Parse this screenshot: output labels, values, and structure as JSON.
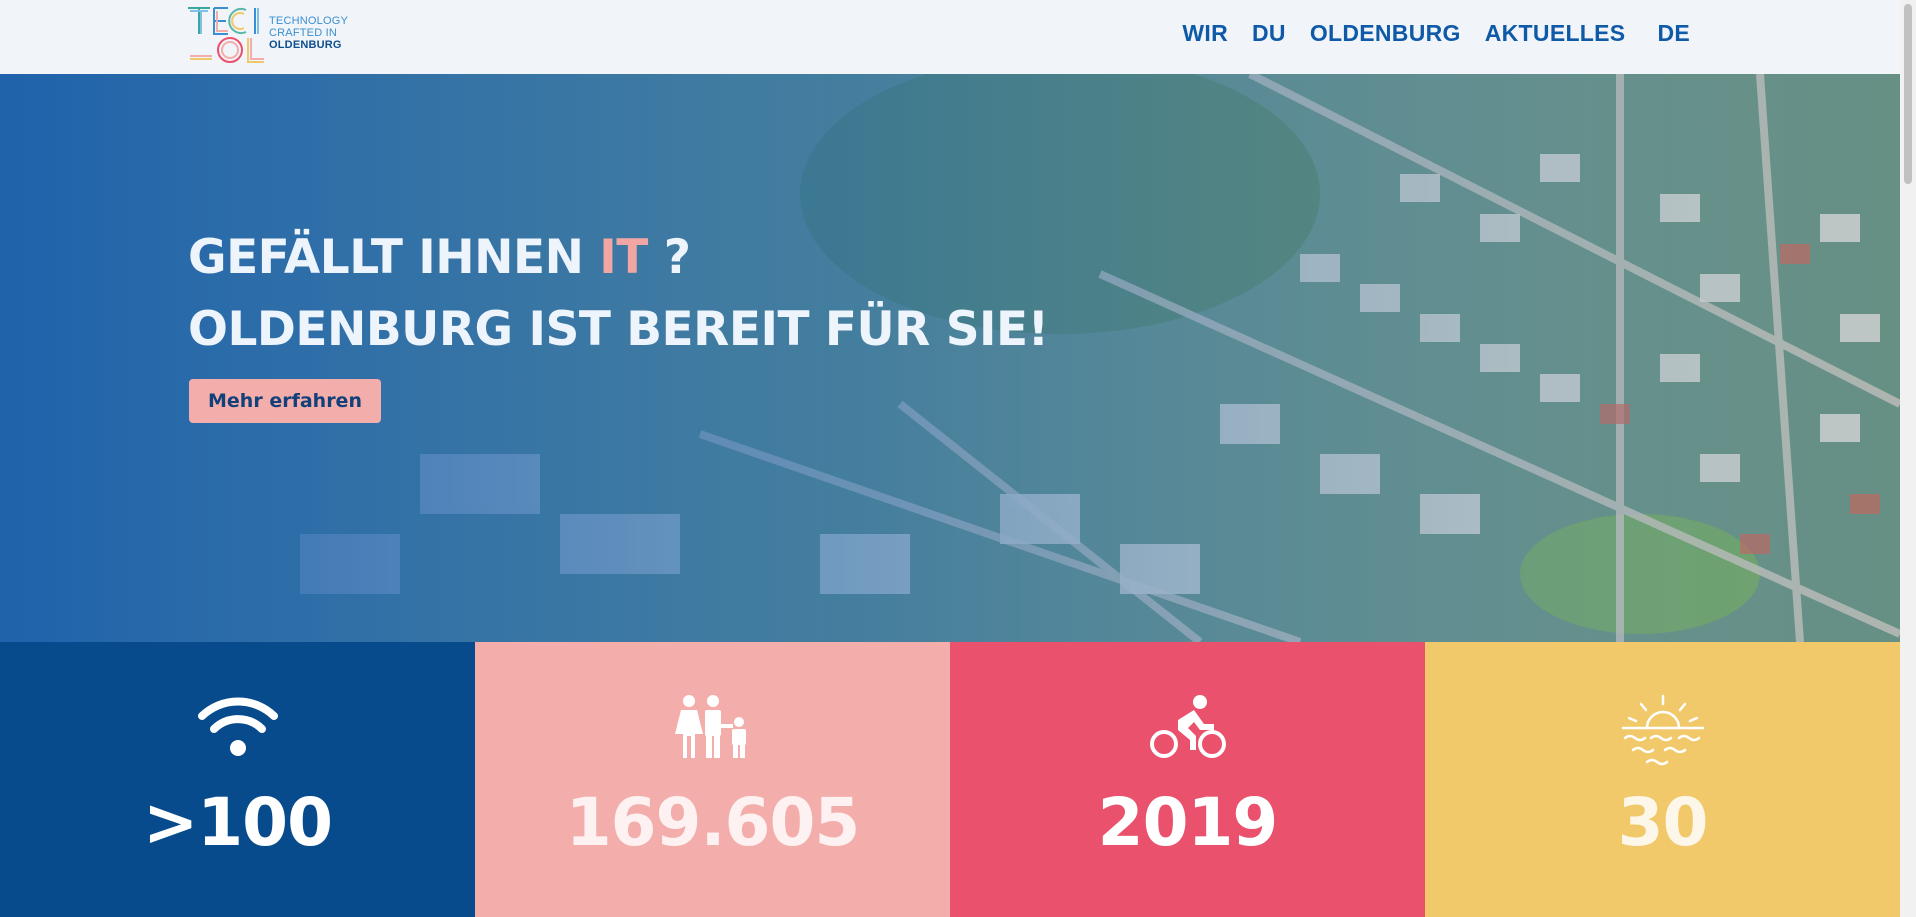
{
  "brand": {
    "mark_line1": "TECI",
    "mark_line2": "OL",
    "tagline_1": "TECHNOLOGY",
    "tagline_2": "CRAFTED IN",
    "tagline_3": "OLDENBURG"
  },
  "nav": {
    "items": [
      {
        "label": "WIR"
      },
      {
        "label": "DU"
      },
      {
        "label": "OLDENBURG"
      },
      {
        "label": "AKTUELLES"
      }
    ],
    "language": "DE"
  },
  "hero": {
    "line1_prefix": "GEFÄLLT IHNEN ",
    "line1_accent": "IT",
    "line1_suffix": " ?",
    "line2": "OLDENBURG IST BEREIT FÜR SIE!",
    "button_label": "Mehr erfahren"
  },
  "stats": [
    {
      "icon": "wifi-icon",
      "value": ">100"
    },
    {
      "icon": "family-icon",
      "value": "169.605"
    },
    {
      "icon": "bicycle-icon",
      "value": "2019"
    },
    {
      "icon": "sunset-icon",
      "value": "30"
    }
  ],
  "colors": {
    "brand_blue": "#0f5aa8",
    "stat_navy": "#074b8c",
    "stat_pink": "#f3aeab",
    "stat_red": "#e9516d",
    "stat_yellow": "#f1c96a",
    "accent_pink": "#f2a6a4"
  }
}
